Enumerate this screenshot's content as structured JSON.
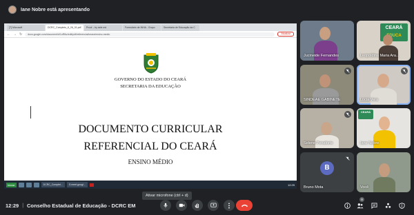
{
  "presenter": {
    "text": "Iane Nobre está apresentando"
  },
  "shared_screen": {
    "tabs": [
      {
        "label": "[T] Microsoft"
      },
      {
        "label": "DCRC_Completo_6_26_01.pdf"
      },
      {
        "label": "Proof – by sele.md"
      },
      {
        "label": "Formulário de INHA - Grupo"
      },
      {
        "label": "Secretaria de Educação da C"
      }
    ],
    "url": "docs.google.com/document/d/1oRfkz/edit/pdf/referencial/ceara/ensino-medio",
    "update_label": "Atualizar",
    "document": {
      "gov_line1": "GOVERNO DO ESTADO DO CEARÁ",
      "gov_line2": "SECRETARIA DA EDUCAÇÃO",
      "title_line1": "DOCUMENTO CURRICULAR",
      "title_line2": "REFERENCIAL DO CEARÁ",
      "subtitle": "ENSINO MÉDIO"
    },
    "taskbar": {
      "start_label": "Iniciar",
      "items": [
        "DCRC_Complet...",
        "G meet.googl..."
      ],
      "clock": "12:29"
    },
    "tooltip": "Ativar microfone (ctrl + d)"
  },
  "participants": [
    {
      "name": "Jucineide Fernandes",
      "muted": false
    },
    {
      "name": "Leopoldina Maria Ara...",
      "muted": false,
      "logo_top": "CEARÁ",
      "logo_bottom": "EDUCA"
    },
    {
      "name": "",
      "muted": true
    },
    {
      "name": "",
      "muted": true
    },
    {
      "name": "Lúcia Vera",
      "muted": false
    },
    {
      "name": "SINDEAE GABINETE",
      "muted": false
    },
    {
      "name": "Selene Penaforte",
      "muted": true
    },
    {
      "name": "Iane Nobre",
      "muted": false
    },
    {
      "name": "Bruno Mota",
      "muted": true,
      "initial": "B"
    },
    {
      "name": "Você",
      "muted": false
    }
  ],
  "bottom_bar": {
    "clock": "12:29",
    "separator": "|",
    "meeting_title": "Conselho Estadual de Educação - DCRC EM",
    "participants_count": "9"
  },
  "colors": {
    "background": "#202124",
    "end_call": "#ea4335",
    "accent": "#8ab4f8"
  }
}
